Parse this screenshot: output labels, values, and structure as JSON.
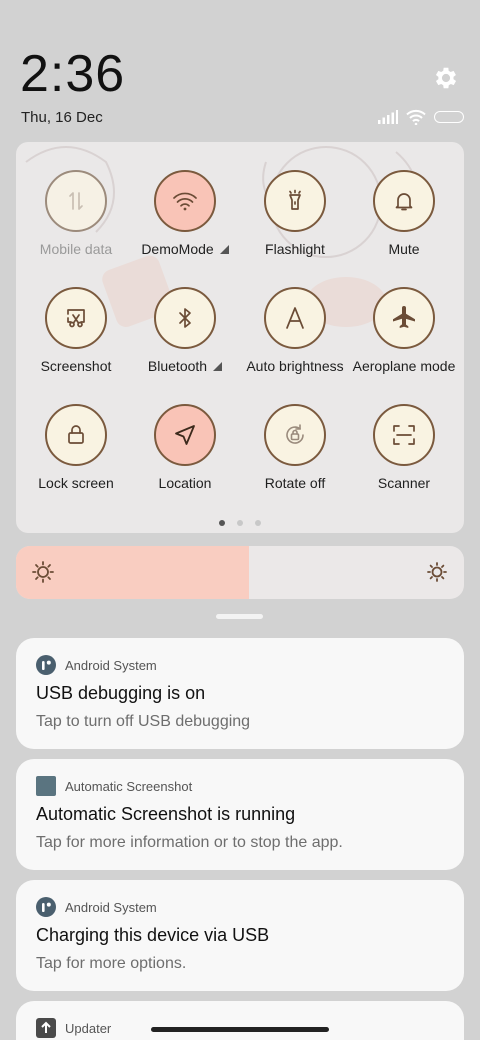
{
  "status": {
    "time": "2:36",
    "date": "Thu, 16 Dec",
    "icons": [
      "signal-icon",
      "wifi-icon",
      "battery-icon",
      "settings-gear-icon"
    ]
  },
  "quick_settings": {
    "tiles": [
      {
        "label": "Mobile data",
        "icon": "mobile-data-icon",
        "state": "unavailable"
      },
      {
        "label": "DemoMode",
        "icon": "wifi-icon",
        "state": "on",
        "expandable": true
      },
      {
        "label": "Flashlight",
        "icon": "flashlight-icon",
        "state": "off"
      },
      {
        "label": "Mute",
        "icon": "bell-icon",
        "state": "off"
      },
      {
        "label": "Screenshot",
        "icon": "screenshot-icon",
        "state": "off"
      },
      {
        "label": "Bluetooth",
        "icon": "bluetooth-icon",
        "state": "off",
        "expandable": true
      },
      {
        "label": "Auto brightness",
        "icon": "auto-brightness-icon",
        "state": "off"
      },
      {
        "label": "Aeroplane mode",
        "icon": "airplane-icon",
        "state": "off"
      },
      {
        "label": "Lock screen",
        "icon": "lock-icon",
        "state": "off"
      },
      {
        "label": "Location",
        "icon": "location-icon",
        "state": "on"
      },
      {
        "label": "Rotate off",
        "icon": "rotate-icon",
        "state": "off"
      },
      {
        "label": "Scanner",
        "icon": "scanner-icon",
        "state": "off"
      }
    ],
    "page_indicator": {
      "pages": 3,
      "current": 1
    }
  },
  "brightness": {
    "level": 0.52,
    "fill_color": "#f9cdc1"
  },
  "notifications": [
    {
      "app": "Android System",
      "icon": "android-system-icon",
      "title": "USB debugging is on",
      "body": "Tap to turn off USB debugging"
    },
    {
      "app": "Automatic Screenshot",
      "icon": "automatic-screenshot-icon",
      "title": "Automatic Screenshot is running",
      "body": "Tap for more information or to stop the app."
    },
    {
      "app": "Android System",
      "icon": "android-system-icon",
      "title": "Charging this device via USB",
      "body": "Tap for more options."
    },
    {
      "app": "Updater",
      "icon": "updater-icon",
      "title": "",
      "body": ""
    }
  ],
  "colors": {
    "accent_on": "#f9c4b7",
    "tile_border": "#7b5a3e",
    "tile_fill": "#f9f3e2"
  }
}
